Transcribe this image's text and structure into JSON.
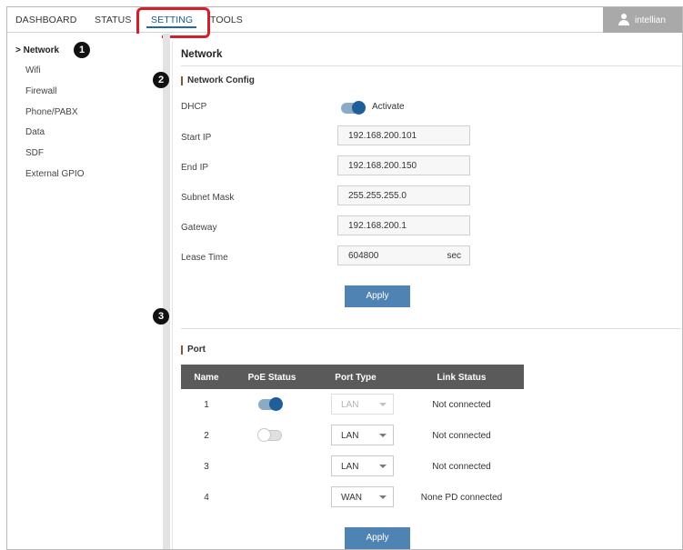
{
  "nav": {
    "tabs": [
      {
        "label": "DASHBOARD"
      },
      {
        "label": "STATUS"
      },
      {
        "label": "SETTING"
      },
      {
        "label": "TOOLS"
      }
    ],
    "user": "intellian"
  },
  "sidebar": {
    "items": [
      {
        "label": "> Network"
      },
      {
        "label": "Wifi"
      },
      {
        "label": "Firewall"
      },
      {
        "label": "Phone/PABX"
      },
      {
        "label": "Data"
      },
      {
        "label": "SDF"
      },
      {
        "label": "External GPIO"
      }
    ]
  },
  "markers": [
    "1",
    "2",
    "3"
  ],
  "page": {
    "title": "Network"
  },
  "network_config": {
    "title": "Network Config",
    "dhcp": {
      "label": "DHCP",
      "toggle": "on",
      "toggle_label": "Activate"
    },
    "start_ip": {
      "label": "Start IP",
      "value": "192.168.200.101"
    },
    "end_ip": {
      "label": "End IP",
      "value": "192.168.200.150"
    },
    "subnet_mask": {
      "label": "Subnet Mask",
      "value": "255.255.255.0"
    },
    "gateway": {
      "label": "Gateway",
      "value": "192.168.200.1"
    },
    "lease_time": {
      "label": "Lease Time",
      "value": "604800",
      "unit": "sec"
    },
    "apply_label": "Apply"
  },
  "port": {
    "title": "Port",
    "columns": [
      "Name",
      "PoE Status",
      "Port Type",
      "Link Status"
    ],
    "rows": [
      {
        "name": "1",
        "poe": "on",
        "type": "LAN",
        "type_disabled": true,
        "link": "Not connected"
      },
      {
        "name": "2",
        "poe": "off",
        "type": "LAN",
        "type_disabled": false,
        "link": "Not connected"
      },
      {
        "name": "3",
        "poe": "",
        "type": "LAN",
        "type_disabled": false,
        "link": "Not connected"
      },
      {
        "name": "4",
        "poe": "",
        "type": "WAN",
        "type_disabled": false,
        "link": "None PD connected"
      }
    ],
    "apply_label": "Apply"
  },
  "colors": {
    "accent": "#1f67a8",
    "highlight": "#d21f2b",
    "button": "#4f83b4"
  }
}
